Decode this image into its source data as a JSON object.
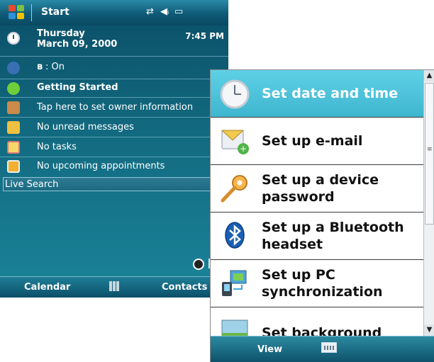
{
  "today": {
    "title": "Start",
    "date_row": {
      "day": "Thursday",
      "date": "March 09, 2000",
      "time": "7:45 PM"
    },
    "bluetooth_status": ": On",
    "items": [
      {
        "label": "Getting Started",
        "icon": "getting-started-icon",
        "bold": true
      },
      {
        "label": "Tap here to set owner information",
        "icon": "owner-icon"
      },
      {
        "label": "No unread messages",
        "icon": "messages-icon"
      },
      {
        "label": "No tasks",
        "icon": "tasks-icon"
      },
      {
        "label": "No upcoming appointments",
        "icon": "calendar-icon"
      }
    ],
    "search": {
      "label": "Live Search"
    },
    "softkeys": {
      "left": "Calendar",
      "right": "Contacts"
    }
  },
  "getting_started": {
    "items": [
      {
        "label": "Set date and time",
        "icon": "clock-icon",
        "selected": true
      },
      {
        "label": "Set up e-mail",
        "icon": "email-icon"
      },
      {
        "label": "Set up a device password",
        "label_lines": [
          "Set up a device",
          "password"
        ],
        "icon": "key-icon"
      },
      {
        "label": "Set up a Bluetooth headset",
        "label_lines": [
          "Set up a Bluetooth",
          "headset"
        ],
        "icon": "bluetooth-icon"
      },
      {
        "label": "Set up PC synchronization",
        "label_lines": [
          "Set up PC",
          "synchronization"
        ],
        "icon": "pc-sync-icon"
      },
      {
        "label": "Set background",
        "icon": "background-icon"
      }
    ],
    "softkey": "View"
  },
  "colors": {
    "today_bg": "#126a80",
    "selection": "#4cc4dc",
    "softkey_bar": "#0d5069"
  }
}
